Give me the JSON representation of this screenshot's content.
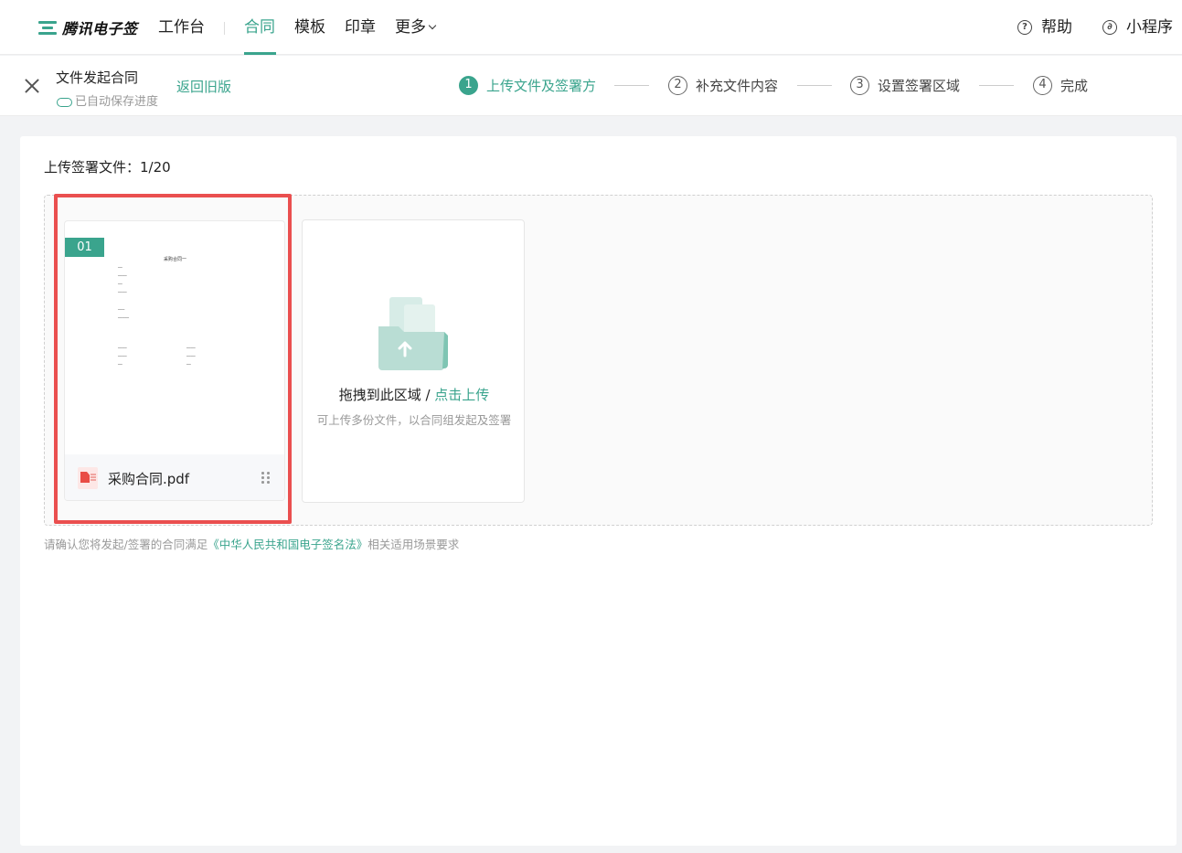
{
  "brand": {
    "name": "腾讯电子签",
    "accent": "#3aa48d"
  },
  "nav": {
    "items": [
      {
        "label": "工作台"
      },
      {
        "label": "合同"
      },
      {
        "label": "模板"
      },
      {
        "label": "印章"
      },
      {
        "label": "更多"
      }
    ],
    "active": "合同",
    "help_label": "帮助",
    "miniprogram_label": "小程序"
  },
  "header": {
    "title": "文件发起合同",
    "autosave_note": "已自动保存进度",
    "back_old_label": "返回旧版"
  },
  "steps": [
    {
      "num": "1",
      "label": "上传文件及签署方",
      "active": true
    },
    {
      "num": "2",
      "label": "补充文件内容",
      "active": false
    },
    {
      "num": "3",
      "label": "设置签署区域",
      "active": false
    },
    {
      "num": "4",
      "label": "完成",
      "active": false
    }
  ],
  "upload": {
    "label": "上传签署文件：1/20",
    "files": [
      {
        "index": "01",
        "name": "采购合同.pdf",
        "preview_title": "采购合同一"
      }
    ],
    "dropzone": {
      "main_text": "拖拽到此区域 / ",
      "link_text": "点击上传",
      "sub_text": "可上传多份文件，以合同组发起及签署"
    }
  },
  "legal": {
    "prefix": "请确认您将发起/签署的合同满足",
    "link": "《中华人民共和国电子签名法》",
    "suffix": "相关适用场景要求"
  }
}
